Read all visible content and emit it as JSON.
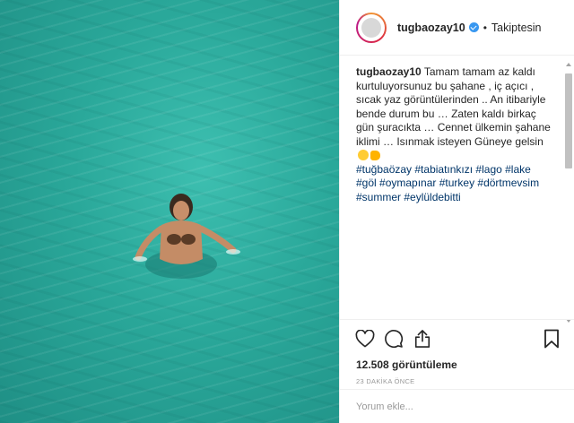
{
  "header": {
    "username": "tugbaozay10",
    "separator": "•",
    "follow_label": "Takiptesin"
  },
  "caption": {
    "username": "tugbaozay10",
    "text": "Tamam tamam az kaldı kurtuluyorsunuz bu şahane , iç açıcı , sıcak yaz görüntülerinden .. An itibariyle bende durum bu … Zaten kaldı birkaç gün şuracıkta … Cennet ülkemin şahane iklimi … Isınmak isteyen Güneye gelsin",
    "hashtags": "#tuğbaözay #tabiatınkızı #lago #lake #göl #oymapınar #turkey #dörtmevsim #summer #eylüldebitti"
  },
  "actions": {
    "like_icon": "heart-icon",
    "comment_icon": "comment-icon",
    "share_icon": "share-icon",
    "save_icon": "bookmark-icon"
  },
  "stats": {
    "views": "12.508 görüntüleme",
    "time_ago": "23 DAKİKA ÖNCE"
  },
  "comment_input": {
    "placeholder": "Yorum ekle..."
  },
  "colors": {
    "water": "#2aa89a",
    "hashtag": "#003569",
    "verified": "#3897f0",
    "muted": "#999999"
  }
}
